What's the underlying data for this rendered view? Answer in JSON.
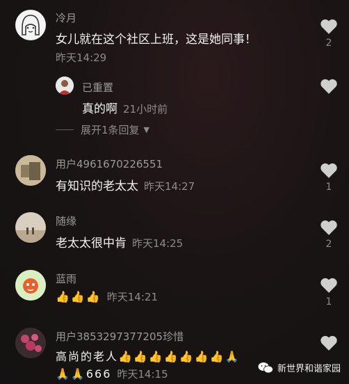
{
  "comments": [
    {
      "username": "冷月",
      "text": "女儿就在这个社区上班，这是她同事！",
      "time": "昨天14:29",
      "likes": "2",
      "reply": {
        "username": "已重置",
        "text": "真的啊",
        "time": "21小时前"
      },
      "expand_label": "展开1条回复"
    },
    {
      "username": "用户4961670226551",
      "text": "有知识的老太太",
      "time": "昨天14:27",
      "likes": "1"
    },
    {
      "username": "随缘",
      "text": "老太太很中肯",
      "time": "昨天14:25",
      "likes": "2"
    },
    {
      "username": "蓝雨",
      "text": "👍👍👍",
      "time": "昨天14:21",
      "likes": "1"
    },
    {
      "username": "用户3853297377205珍惜",
      "text": "高尚的老人👍👍👍👍👍👍👍🙏",
      "text2": "🙏🙏666",
      "time": "昨天14:15",
      "likes": ""
    }
  ],
  "watermark": "新世界和谐家园",
  "colors": {
    "heart": "#cfcfcf",
    "muted": "#8c8c8c",
    "text": "#f2f2f2"
  }
}
